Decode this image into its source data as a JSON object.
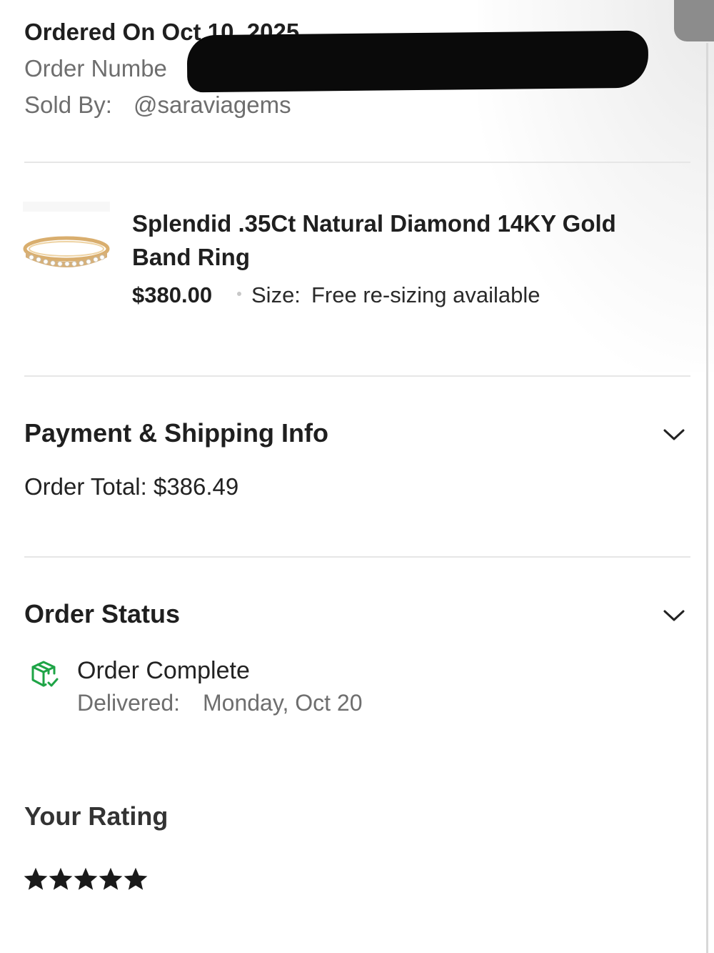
{
  "order_header": {
    "ordered_on": "Ordered On Oct 10, 2025",
    "order_number_label": "Order Numbe",
    "sold_by_label": "Sold By:",
    "seller_handle": "@saraviagems"
  },
  "item": {
    "title_line1": "Splendid .35Ct Natural Diamond 14KY Gold",
    "title_line2": "Band Ring",
    "price": "$380.00",
    "size_label": "Size:",
    "size_value": "Free re-sizing available",
    "image_icon": "gold-diamond-band-ring"
  },
  "payment": {
    "heading": "Payment & Shipping Info",
    "order_total": "Order Total: $386.49"
  },
  "status": {
    "heading": "Order Status",
    "status_text": "Order Complete",
    "delivered_label": "Delivered:",
    "delivered_date": "Monday, Oct 20",
    "status_icon": "package-check-icon",
    "status_color": "#1ea446"
  },
  "rating": {
    "heading": "Your Rating",
    "stars": 5,
    "max_stars": 5
  },
  "icons": {
    "expand": "chevron-down-icon"
  }
}
